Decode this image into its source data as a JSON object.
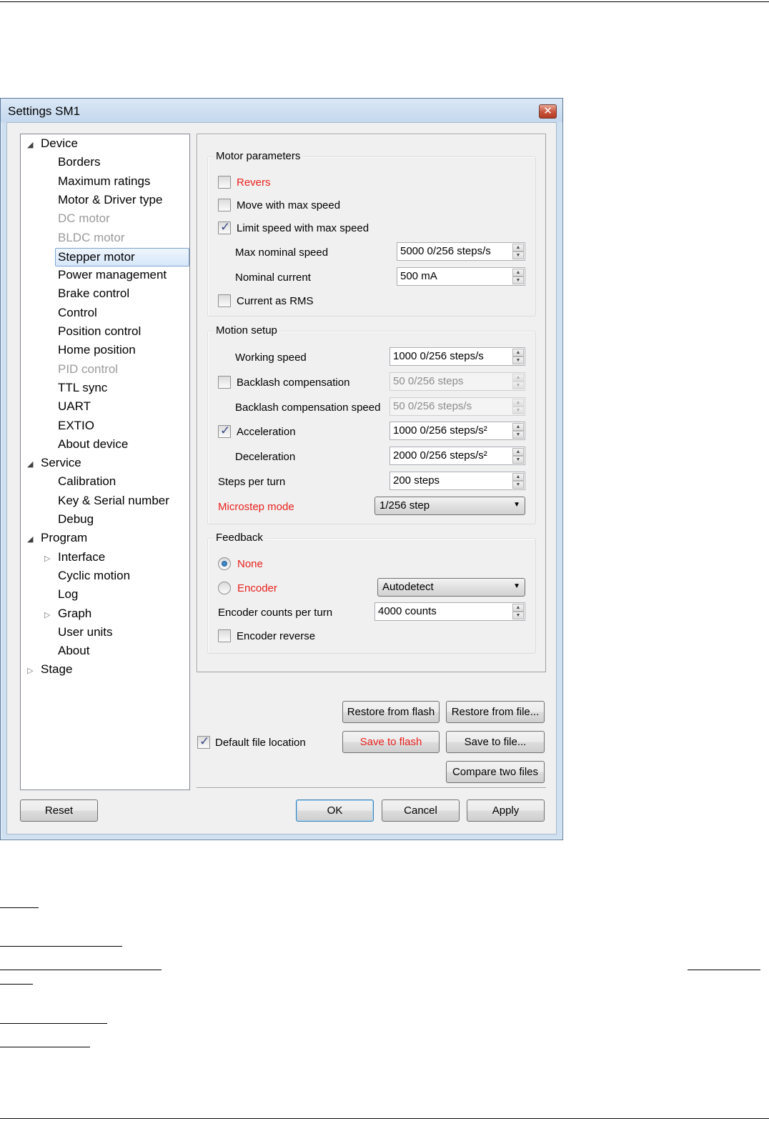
{
  "window": {
    "title": "Settings SM1",
    "close_glyph": "✕"
  },
  "tree": [
    {
      "label": "Device",
      "level": 0,
      "expander": "expanded",
      "state": "normal"
    },
    {
      "label": "Borders",
      "level": 1,
      "state": "normal"
    },
    {
      "label": "Maximum ratings",
      "level": 1,
      "state": "normal"
    },
    {
      "label": "Motor & Driver type",
      "level": 1,
      "state": "normal"
    },
    {
      "label": "DC motor",
      "level": 1,
      "state": "disabled"
    },
    {
      "label": "BLDC motor",
      "level": 1,
      "state": "disabled"
    },
    {
      "label": "Stepper motor",
      "level": 1,
      "state": "selected"
    },
    {
      "label": "Power management",
      "level": 1,
      "state": "normal"
    },
    {
      "label": "Brake control",
      "level": 1,
      "state": "normal"
    },
    {
      "label": "Control",
      "level": 1,
      "state": "normal"
    },
    {
      "label": "Position control",
      "level": 1,
      "state": "normal"
    },
    {
      "label": "Home position",
      "level": 1,
      "state": "normal"
    },
    {
      "label": "PID control",
      "level": 1,
      "state": "disabled"
    },
    {
      "label": "TTL sync",
      "level": 1,
      "state": "normal"
    },
    {
      "label": "UART",
      "level": 1,
      "state": "normal"
    },
    {
      "label": "EXTIO",
      "level": 1,
      "state": "normal"
    },
    {
      "label": "About device",
      "level": 1,
      "state": "normal"
    },
    {
      "label": "Service",
      "level": 0,
      "expander": "expanded",
      "state": "normal"
    },
    {
      "label": "Calibration",
      "level": 1,
      "state": "normal"
    },
    {
      "label": "Key & Serial number",
      "level": 1,
      "state": "normal"
    },
    {
      "label": "Debug",
      "level": 1,
      "state": "normal"
    },
    {
      "label": "Program",
      "level": 0,
      "expander": "expanded",
      "state": "normal"
    },
    {
      "label": "Interface",
      "level": 1,
      "expander": "collapsed",
      "state": "normal"
    },
    {
      "label": "Cyclic motion",
      "level": 1,
      "state": "normal"
    },
    {
      "label": "Log",
      "level": 1,
      "state": "normal"
    },
    {
      "label": "Graph",
      "level": 1,
      "expander": "collapsed",
      "state": "normal"
    },
    {
      "label": "User units",
      "level": 1,
      "state": "normal"
    },
    {
      "label": "About",
      "level": 1,
      "state": "normal"
    },
    {
      "label": "Stage",
      "level": 0,
      "expander": "collapsed",
      "state": "normal"
    }
  ],
  "motor_parameters": {
    "title": "Motor parameters",
    "revers": {
      "label": "Revers",
      "checked": false
    },
    "move_max_speed": {
      "label": "Move with max speed",
      "checked": false
    },
    "limit_speed": {
      "label": "Limit speed with max speed",
      "checked": true
    },
    "max_nominal_speed": {
      "label": "Max nominal speed",
      "value": "5000 0/256 steps/s"
    },
    "nominal_current": {
      "label": "Nominal current",
      "value": "500 mA"
    },
    "current_rms": {
      "label": "Current as RMS",
      "checked": false
    }
  },
  "motion_setup": {
    "title": "Motion setup",
    "working_speed": {
      "label": "Working speed",
      "value": "1000 0/256 steps/s"
    },
    "backlash": {
      "label": "Backlash compensation",
      "checked": false,
      "value": "50 0/256 steps"
    },
    "backlash_speed": {
      "label": "Backlash compensation speed",
      "value": "50 0/256 steps/s"
    },
    "acceleration": {
      "label": "Acceleration",
      "checked": true,
      "value": "1000 0/256 steps/s²"
    },
    "deceleration": {
      "label": "Deceleration",
      "value": "2000 0/256 steps/s²"
    },
    "steps_per_turn": {
      "label": "Steps per turn",
      "value": "200 steps"
    },
    "microstep": {
      "label": "Microstep mode",
      "value": "1/256 step"
    }
  },
  "feedback": {
    "title": "Feedback",
    "none": {
      "label": "None",
      "selected": true
    },
    "encoder": {
      "label": "Encoder",
      "selected": false,
      "combo_value": "Autodetect"
    },
    "counts_per_turn": {
      "label": "Encoder counts per turn",
      "value": "4000 counts"
    },
    "encoder_reverse": {
      "label": "Encoder reverse",
      "checked": false
    }
  },
  "file_actions": {
    "restore_flash": "Restore from flash",
    "restore_file": "Restore from file...",
    "default_location": {
      "label": "Default file location",
      "checked": true
    },
    "save_flash": "Save to flash",
    "save_file": "Save to file...",
    "compare": "Compare two files"
  },
  "footer": {
    "reset": "Reset",
    "ok": "OK",
    "cancel": "Cancel",
    "apply": "Apply"
  },
  "glyphs": {
    "check": "✓",
    "tree_expanded": "◢",
    "tree_collapsed": "▷",
    "spin_up": "▲",
    "spin_down": "▼",
    "combo_arrow": "▼"
  },
  "colors": {
    "accent_red": "#e8211c",
    "selection": "#d7e7fa",
    "window_frame": "#cfe0f1"
  }
}
